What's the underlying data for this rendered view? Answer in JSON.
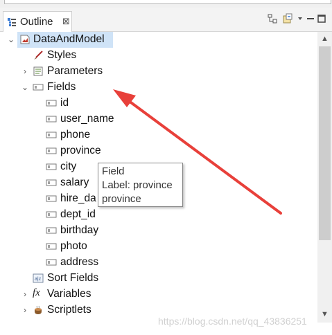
{
  "view": {
    "tab_title": "Outline",
    "close_glyph": "⊠",
    "toolbar": [
      "collapse-all-icon",
      "link-editor-icon",
      "view-menu-icon",
      "minimize-icon",
      "maximize-icon"
    ]
  },
  "tree": {
    "root": {
      "label": "DataAndModel",
      "icon": "report-icon",
      "expanded": true,
      "selected": true
    },
    "styles": {
      "label": "Styles",
      "icon": "brush-icon"
    },
    "parameters": {
      "label": "Parameters",
      "icon": "parameters-icon",
      "expanded": false
    },
    "fields": {
      "label": "Fields",
      "icon": "field-group-icon",
      "expanded": true,
      "items": [
        "id",
        "user_name",
        "phone",
        "province",
        "city",
        "salary",
        "hire_da",
        "dept_id",
        "birthday",
        "photo",
        "address"
      ]
    },
    "sort_fields": {
      "label": "Sort Fields",
      "icon": "sort-icon"
    },
    "variables": {
      "label": "Variables",
      "icon": "fx-icon",
      "glyph": "fx",
      "expanded": false
    },
    "scriptlets": {
      "label": "Scriptlets",
      "icon": "bean-icon",
      "expanded": false
    }
  },
  "tooltip": {
    "line1": "Field",
    "line2": "Label: province",
    "line3": "province"
  },
  "watermark": "https://blog.csdn.net/qq_43836251",
  "colors": {
    "selection": "#cfe3f7",
    "arrow": "#e8403a",
    "field_icon_border": "#7a7a7a"
  }
}
